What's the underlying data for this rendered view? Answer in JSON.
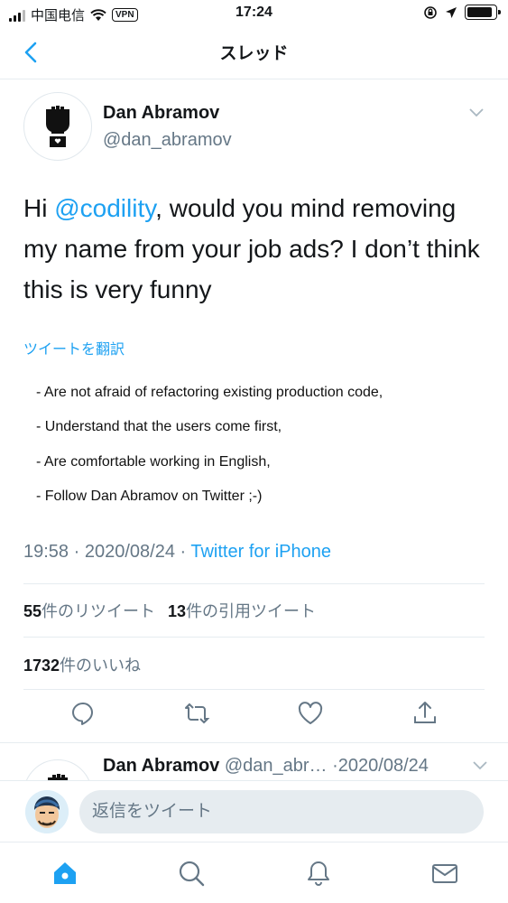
{
  "status_bar": {
    "carrier": "中国电信",
    "vpn": "VPN",
    "time": "17:24",
    "battery_level_percent": 90
  },
  "nav": {
    "title": "スレッド",
    "back_icon": "chevron-left-icon"
  },
  "tweet": {
    "author_name": "Dan Abramov",
    "author_handle": "@dan_abramov",
    "text_prefix": "Hi ",
    "mention": "@codility",
    "text_suffix": ", would you mind removing my name from your job ads? I don’t think this is very funny",
    "translate_link": "ツイートを翻訳",
    "image_lines": [
      "- Are not afraid of refactoring existing production code,",
      "- Understand that the users come first,",
      "- Are comfortable working in English,",
      "- Follow Dan Abramov on Twitter ;-)"
    ],
    "time": "19:58",
    "separator": " · ",
    "date": "2020/08/24",
    "source": "Twitter for iPhone",
    "retweets_count": "55",
    "retweets_label": "件のリツイート",
    "quotes_count": "13",
    "quotes_label": "件の引用ツイート",
    "likes_count": "1732",
    "likes_label": "件のいいね"
  },
  "reply": {
    "author_name": "Dan Abramov",
    "author_handle": "@dan_abr…",
    "date": "·2020/08/24"
  },
  "composer": {
    "placeholder": "返信をツイート"
  },
  "colors": {
    "accent": "#1da1f2",
    "muted": "#657786",
    "text": "#14171a",
    "divider": "#e6ecf0"
  }
}
